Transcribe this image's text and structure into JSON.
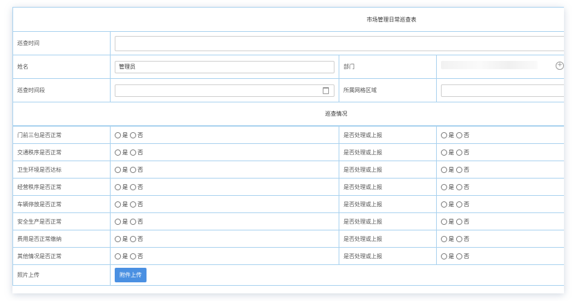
{
  "title": "市场管理日常巡查表",
  "fields": {
    "inspect_time_label": "巡查时间",
    "inspect_time_value": "",
    "name_label": "姓名",
    "name_value": "管理员",
    "dept_label": "部门",
    "period_label": "巡查时间段",
    "period_value": "",
    "grid_label": "所属网格区域",
    "grid_value": ""
  },
  "section_title": "巡查情况",
  "options": {
    "yes": "是",
    "no": "否"
  },
  "report_label": "是否处理或上报",
  "checks": [
    "门前三包是否正常",
    "交通秩序是否正常",
    "卫生环境是否达标",
    "经营秩序是否正常",
    "车辆停放是否正常",
    "安全生产是否正常",
    "费用是否正常缴纳",
    "其他情况是否正常"
  ],
  "upload": {
    "label": "照片上传",
    "button": "附件上传"
  },
  "icons": {
    "calendar": "calendar-icon",
    "add": "add-circle-icon"
  }
}
